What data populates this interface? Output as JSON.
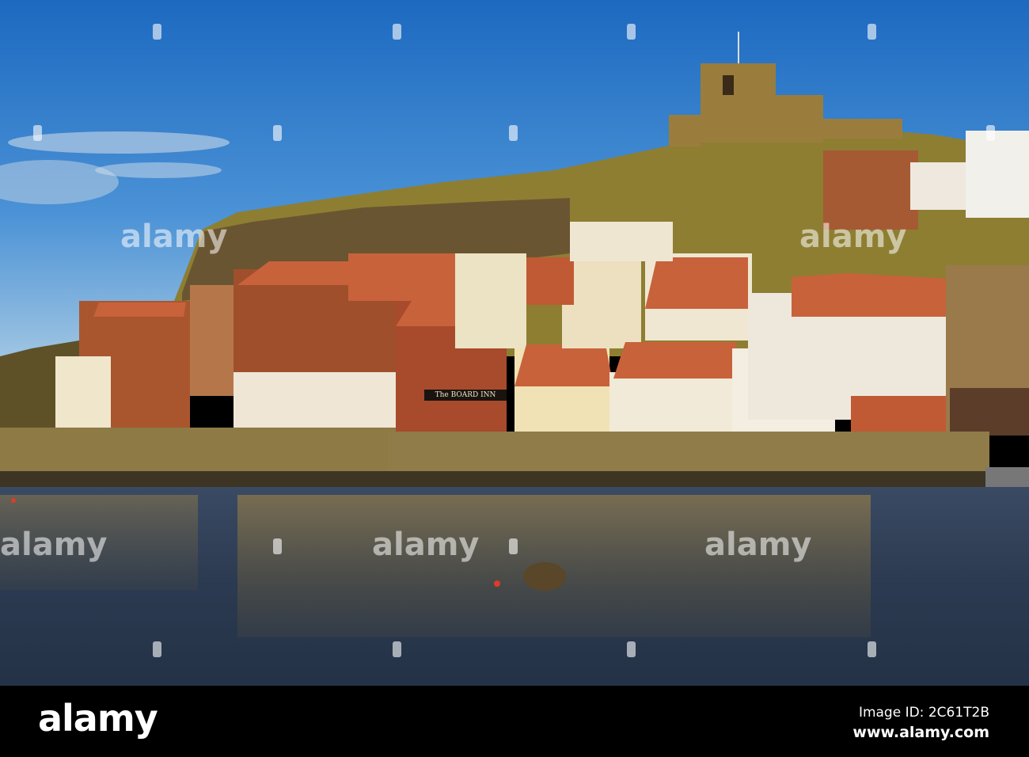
{
  "photo": {
    "sign_text": "The BOARD INN",
    "colors": {
      "sky_top": "#1f6fc4",
      "sky_bottom": "#7fb3de",
      "hill": "#8a7a2e",
      "cliff": "#5b4a2c",
      "water": "#2e3d52",
      "brick": "#a9562f",
      "roof": "#c8623a",
      "white_house": "#efe6cc",
      "quay": "#8d7a45"
    }
  },
  "watermark": {
    "text": "alamy"
  },
  "footer": {
    "logo": "alamy",
    "image_id": "Image ID: 2C61T2B",
    "site": "www.alamy.com"
  }
}
